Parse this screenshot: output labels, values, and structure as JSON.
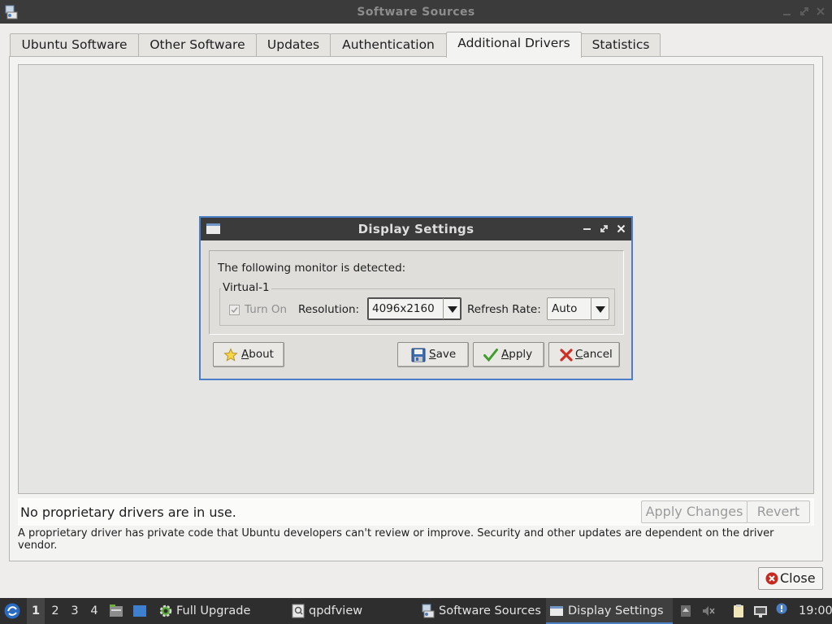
{
  "window": {
    "title": "Software Sources",
    "tabs": [
      {
        "label": "Ubuntu Software"
      },
      {
        "label": "Other Software"
      },
      {
        "label": "Updates"
      },
      {
        "label": "Authentication"
      },
      {
        "label": "Additional Drivers",
        "active": true
      },
      {
        "label": "Statistics"
      }
    ],
    "status_text": "No proprietary drivers are in use.",
    "apply_changes_label": "Apply Changes",
    "revert_label": "Revert",
    "info_text": "A proprietary driver has private code that Ubuntu developers can't review or improve. Security and other updates are dependent on the driver vendor.",
    "close_label": "Close"
  },
  "dialog": {
    "title": "Display Settings",
    "detected_text": "The following monitor is detected:",
    "monitor_name": "Virtual-1",
    "turn_on_label": "Turn On",
    "turn_on_checked": true,
    "resolution_label": "Resolution:",
    "resolution_value": "4096x2160",
    "refresh_label": "Refresh Rate:",
    "refresh_value": "Auto",
    "buttons": {
      "about": "About",
      "save": "Save",
      "apply": "Apply",
      "cancel": "Cancel"
    }
  },
  "taskbar": {
    "workspaces": [
      "1",
      "2",
      "3",
      "4"
    ],
    "active_workspace": "1",
    "tasks": [
      {
        "label": "Full Upgrade",
        "icon": "gear-icon"
      },
      {
        "label": "qpdfview",
        "icon": "pdf-viewer-icon"
      },
      {
        "label": "Software Sources",
        "icon": "software-sources-icon"
      },
      {
        "label": "Display Settings",
        "icon": "window-icon",
        "active": true
      }
    ],
    "clock": "19:00"
  },
  "colors": {
    "titlebar_bg": "#3b3b3b",
    "accent": "#4a7fc8",
    "taskbar_bg": "#2e2e2e"
  }
}
